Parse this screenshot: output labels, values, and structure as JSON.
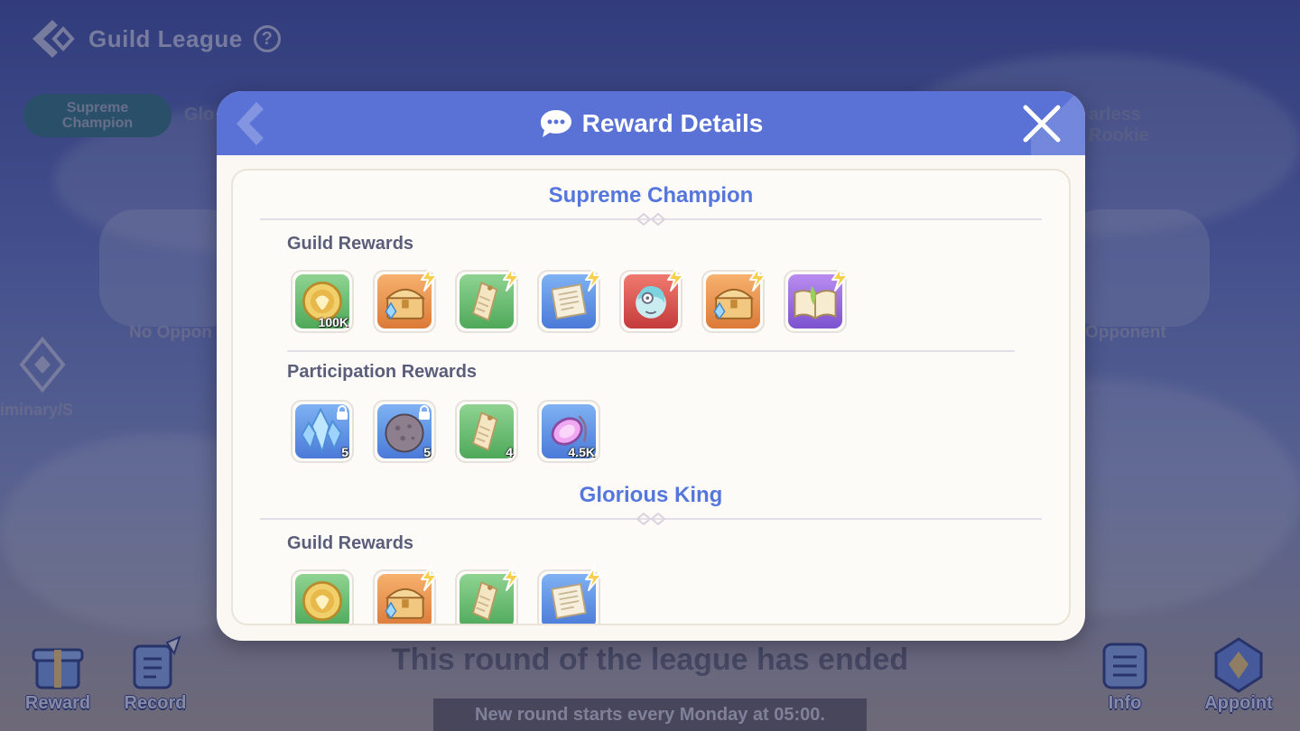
{
  "background": {
    "title": "Guild League",
    "help_glyph": "?",
    "tabs": [
      "Supreme\nChampion",
      "Glo",
      "arless Rookie"
    ],
    "opponent_left": "No Oppon",
    "opponent_right": "Opponent",
    "left_nav_label": "iminary/S",
    "status": "This round of the league has ended",
    "next_round": "New round starts every Monday at 05:00.",
    "buttons": {
      "reward": "Reward",
      "record": "Record",
      "info": "Info",
      "appoint": "Appoint"
    }
  },
  "modal": {
    "title": "Reward Details",
    "tiers": [
      {
        "name": "Supreme Champion",
        "guild_label": "Guild Rewards",
        "guild_items": [
          {
            "icon": "guild-coin-icon",
            "bg": "green",
            "qty": "100K",
            "upgrade": false
          },
          {
            "icon": "treasure-chest-icon",
            "bg": "orange",
            "qty": "",
            "upgrade": true
          },
          {
            "icon": "scroll-tag-icon",
            "bg": "green",
            "qty": "",
            "upgrade": true
          },
          {
            "icon": "document-icon",
            "bg": "blue",
            "qty": "",
            "upgrade": true
          },
          {
            "icon": "avatar-frame-icon",
            "bg": "red",
            "qty": "",
            "upgrade": true
          },
          {
            "icon": "treasure-chest-icon",
            "bg": "orange",
            "qty": "",
            "upgrade": true
          },
          {
            "icon": "spell-book-icon",
            "bg": "purple",
            "qty": "",
            "upgrade": true
          }
        ],
        "participation_label": "Participation Rewards",
        "participation_items": [
          {
            "icon": "crystal-icon",
            "bg": "blue",
            "qty": "5",
            "locked": true
          },
          {
            "icon": "ore-stone-icon",
            "bg": "blue",
            "qty": "5",
            "locked": true
          },
          {
            "icon": "scroll-tag-icon",
            "bg": "green",
            "qty": "4",
            "locked": false
          },
          {
            "icon": "pink-gem-icon",
            "bg": "blue",
            "qty": "4.5K",
            "locked": false
          }
        ]
      },
      {
        "name": "Glorious King",
        "guild_label": "Guild Rewards",
        "guild_items": [
          {
            "icon": "guild-coin-icon",
            "bg": "green",
            "qty": "",
            "upgrade": false
          },
          {
            "icon": "treasure-chest-icon",
            "bg": "orange",
            "qty": "",
            "upgrade": true
          },
          {
            "icon": "scroll-tag-icon",
            "bg": "green",
            "qty": "",
            "upgrade": true
          },
          {
            "icon": "document-icon",
            "bg": "blue",
            "qty": "",
            "upgrade": true
          }
        ]
      }
    ]
  }
}
